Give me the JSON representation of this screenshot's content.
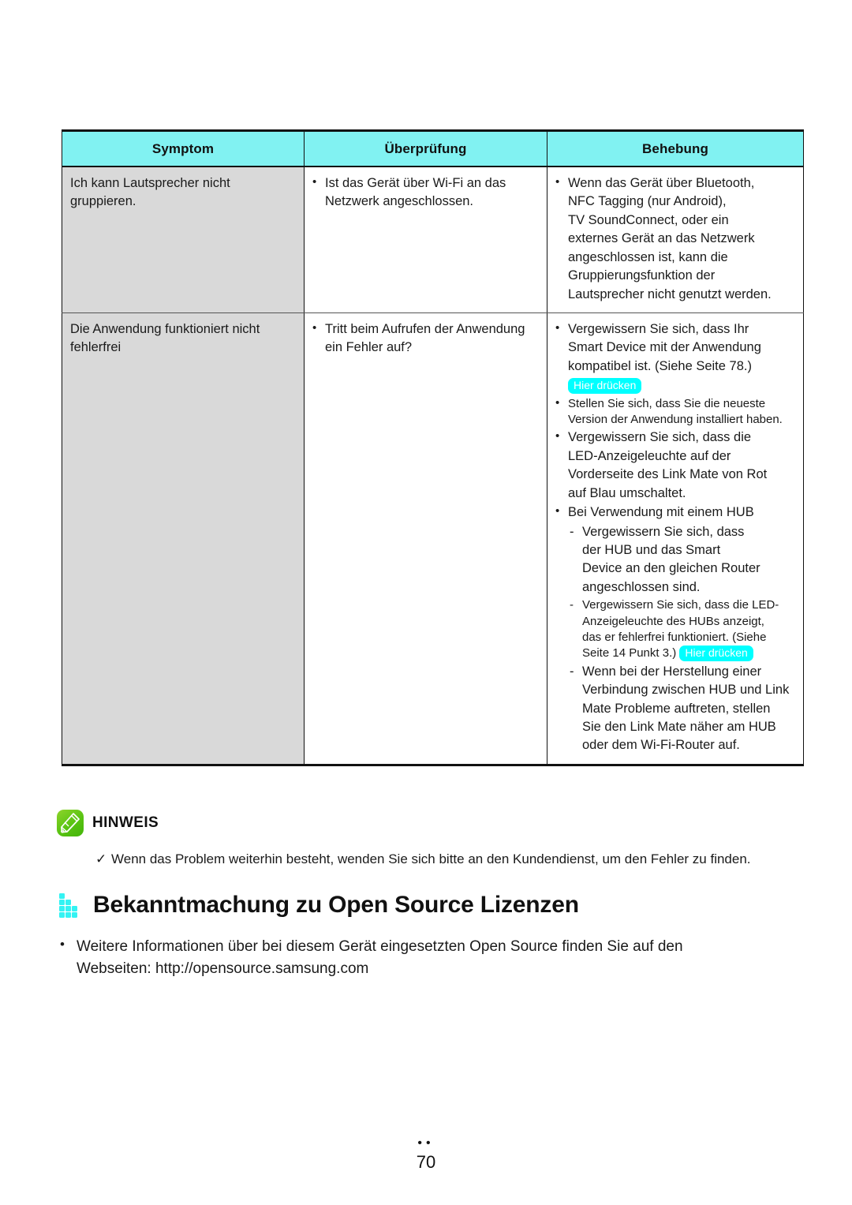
{
  "table": {
    "headers": [
      "Symptom",
      "Überprüfung",
      "Behebung"
    ],
    "rows": [
      {
        "symptom": [
          "Ich kann Lautsprecher nicht",
          "gruppieren."
        ],
        "check": [
          {
            "type": "bullet",
            "lines": [
              "Ist das Gerät über Wi-Fi an das",
              "Netzwerk angeschlossen."
            ]
          }
        ],
        "fix": [
          {
            "type": "bullet",
            "lines": [
              "Wenn das Gerät über Bluetooth,",
              "NFC Tagging (nur Android),",
              "TV SoundConnect, oder ein",
              "externes Gerät an das Netzwerk",
              "angeschlossen ist, kann die",
              "Gruppierungsfunktion der",
              "Lautsprecher nicht genutzt werden."
            ]
          }
        ]
      },
      {
        "symptom": [
          "Die Anwendung funktioniert nicht",
          "fehlerfrei"
        ],
        "check": [
          {
            "type": "bullet",
            "lines": [
              "Tritt beim Aufrufen der Anwendung",
              "ein Fehler auf?"
            ]
          }
        ],
        "fix": [
          {
            "type": "bullet",
            "lines": [
              "Vergewissern Sie sich, dass Ihr",
              "Smart Device mit der Anwendung",
              "kompatibel ist. (Siehe Seite 78.)"
            ],
            "badge_after": "Hier drücken"
          },
          {
            "type": "bullet",
            "small": true,
            "lines": [
              "Stellen Sie sich, dass Sie die neueste",
              "Version der Anwendung installiert haben."
            ]
          },
          {
            "type": "bullet",
            "lines": [
              "Vergewissern Sie sich, dass die",
              "LED-Anzeigeleuchte auf der",
              "Vorderseite des Link Mate von Rot",
              "auf Blau umschaltet."
            ]
          },
          {
            "type": "bullet",
            "lines": [
              "Bei Verwendung mit einem HUB"
            ],
            "sub": [
              {
                "type": "dash",
                "lines": [
                  "Vergewissern Sie sich, dass",
                  "der HUB und das Smart",
                  "Device an den gleichen Router",
                  "angeschlossen sind."
                ]
              },
              {
                "type": "dash",
                "small": true,
                "lines": [
                  "Vergewissern Sie sich, dass die LED-",
                  "Anzeigeleuchte des HUBs anzeigt,",
                  "das er fehlerfrei funktioniert. (Siehe",
                  "Seite 14 Punkt 3.)"
                ],
                "badge_inline": "Hier drücken"
              },
              {
                "type": "dash",
                "lines": [
                  "Wenn bei der Herstellung einer",
                  "Verbindung zwischen HUB und Link",
                  "Mate Probleme auftreten, stellen",
                  "Sie den Link Mate näher am HUB",
                  "oder dem Wi-Fi-Router auf."
                ]
              }
            ]
          }
        ]
      }
    ]
  },
  "note": {
    "icon": "pencil-note-icon",
    "title": "HINWEIS",
    "check_mark": "✓",
    "text": "Wenn das Problem weiterhin besteht, wenden Sie sich bitte an den Kundendienst, um den Fehler zu finden."
  },
  "section": {
    "icon": "cyan-pixel-stairs-icon",
    "title": "Bekanntmachung zu Open Source Lizenzen",
    "bullet": "•",
    "body_lines": [
      "Weitere Informationen über bei diesem Gerät eingesetzten Open Source finden Sie auf den",
      "Webseiten: http://opensource.samsung.com"
    ]
  },
  "footer": {
    "dots": "••",
    "page_number": "70"
  },
  "colors": {
    "header_cyan": "#81f2f2",
    "badge_cyan": "#00ffff",
    "symptom_gray": "#d9d9d9",
    "note_green": "#59c312",
    "section_icon_cyan": "#33f3f3"
  }
}
